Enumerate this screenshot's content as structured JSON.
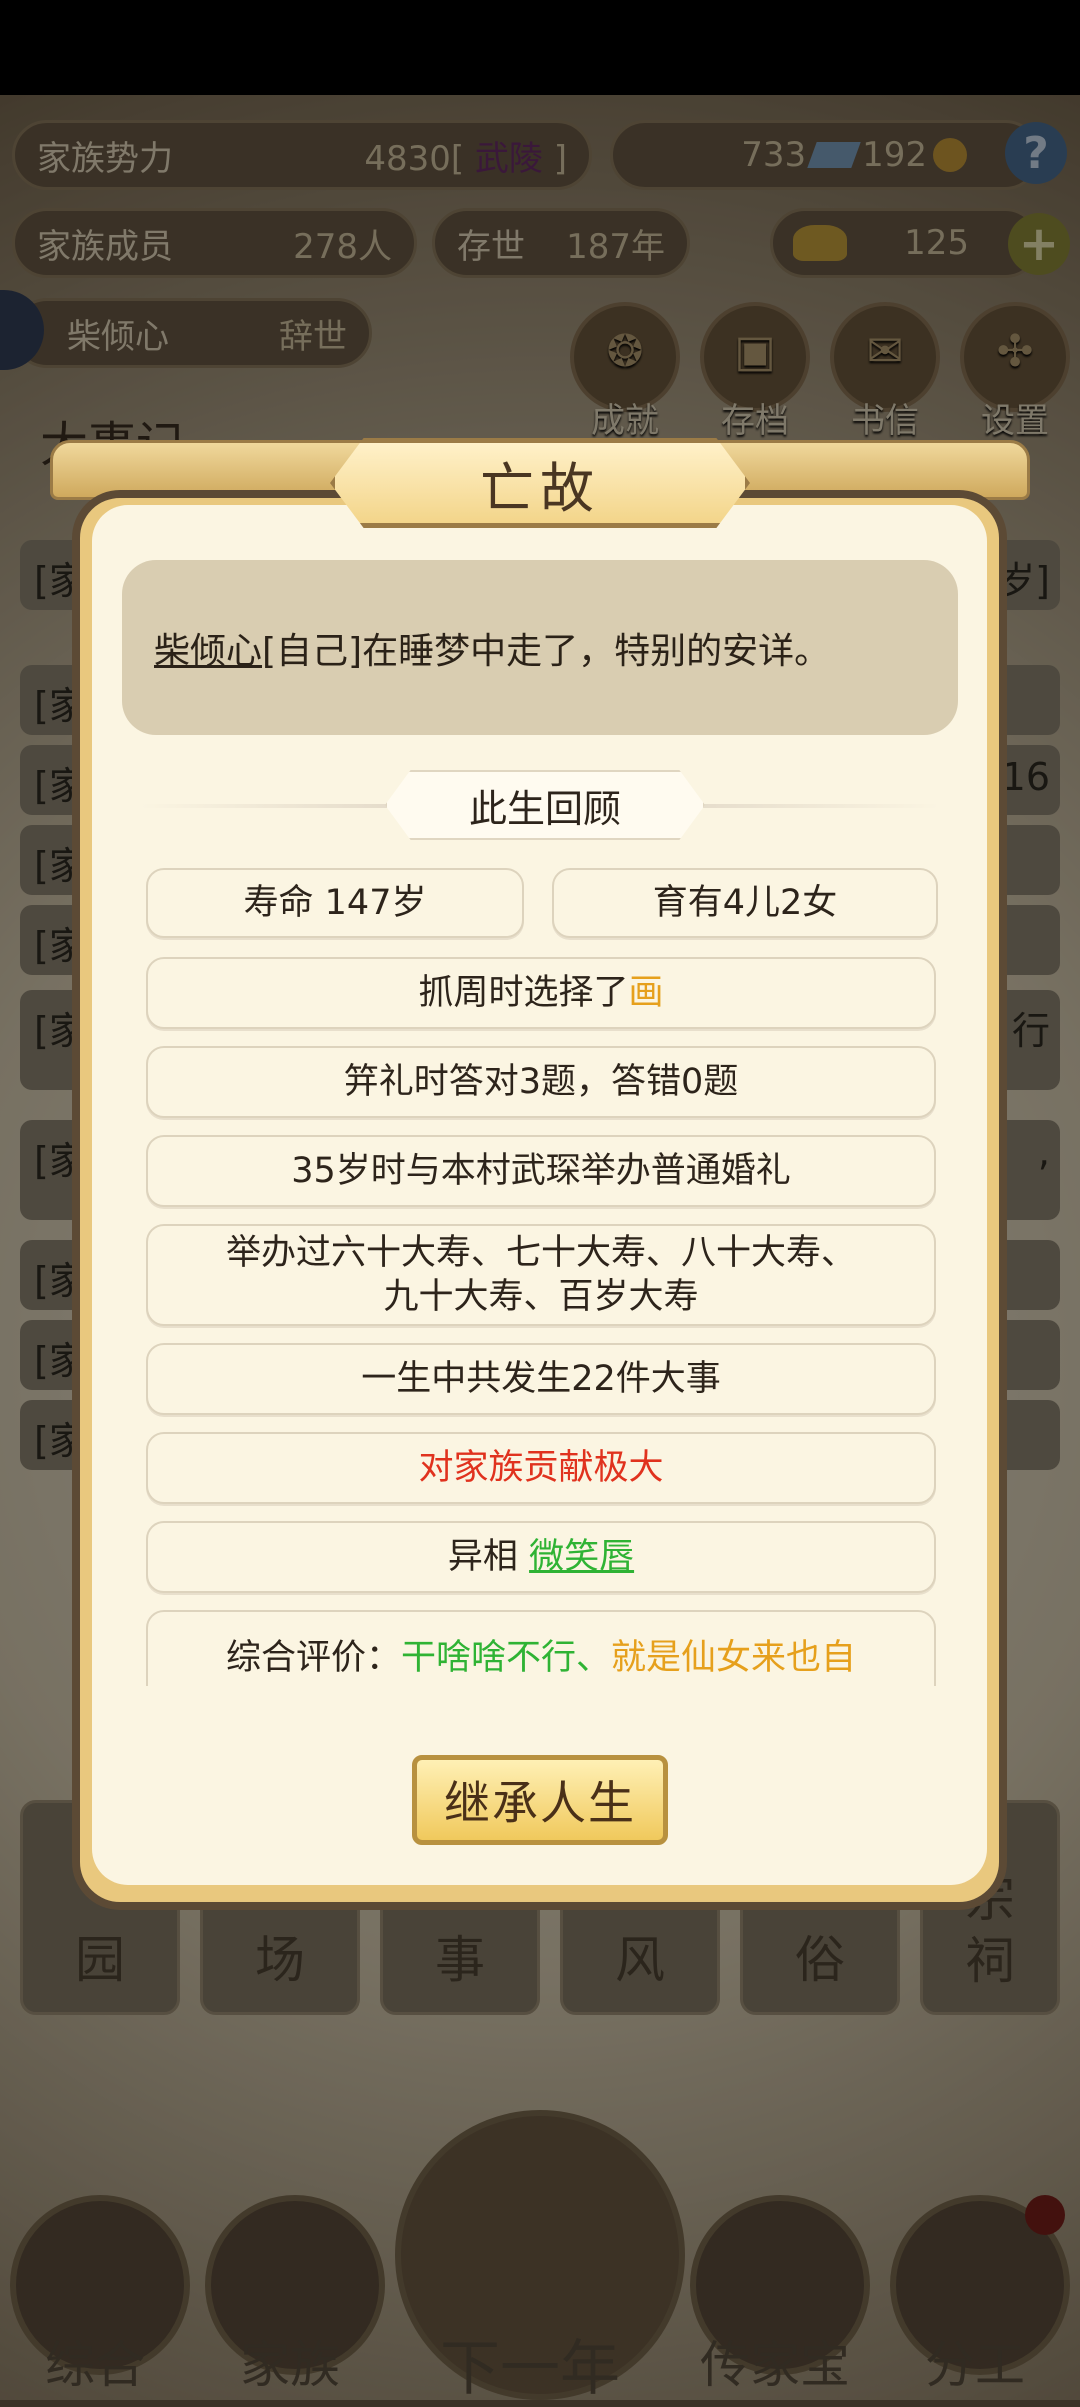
{
  "header": {
    "power_label": "家族势力",
    "power_value": "4830",
    "power_bracket_open": "[",
    "power_bracket_close": "]",
    "power_rank": "武陵",
    "currency_a": "733",
    "currency_b": "192",
    "help_icon": "?",
    "members_label": "家族成员",
    "members_value": "278人",
    "exist_label": "存世",
    "exist_value": "187年",
    "gold_value": "125",
    "add_icon": "+",
    "person_name": "柴倾心",
    "person_status": "辞世"
  },
  "top_buttons": [
    {
      "label": "成就",
      "icon": "achievement-icon"
    },
    {
      "label": "存档",
      "icon": "save-icon"
    },
    {
      "label": "书信",
      "icon": "letter-icon"
    },
    {
      "label": "设置",
      "icon": "settings-icon"
    }
  ],
  "background": {
    "section_title": "大事记",
    "rows": [
      "[家",
      "[家",
      "[家",
      "[家",
      "[家",
      "[家",
      "[家",
      "[家",
      "[家",
      "[家"
    ],
    "row_tails": [
      "岁]",
      "",
      "16",
      "",
      "",
      "行",
      ",",
      "",
      "",
      ""
    ],
    "tiles": [
      "园",
      "场",
      "事",
      "风",
      "俗",
      "宗祠"
    ],
    "nav": [
      "综合",
      "家族",
      "下一年",
      "传家宝",
      "分工"
    ]
  },
  "modal": {
    "title": "亡故",
    "message_name": "柴倾心",
    "message_rest": "[自己]在睡梦中走了，特别的安详。",
    "section_title": "此生回顾",
    "lifespan": "寿命 147岁",
    "children": "育有4儿2女",
    "zhuazhou_prefix": "抓周时选择了",
    "zhuazhou_item": "画",
    "jili": "笄礼时答对3题，答错0题",
    "wedding": "35岁时与本村武琛举办普通婚礼",
    "birthdays_line1": "举办过六十大寿、七十大寿、八十大寿、",
    "birthdays_line2": "九十大寿、百岁大寿",
    "events": "一生中共发生22件大事",
    "contribution": "对家族贡献极大",
    "trait_prefix": "异相",
    "trait_value": "微笑唇",
    "eval_prefix": "综合评价：",
    "eval_green": "干啥啥不行、",
    "eval_orange": "就是仙女来也自",
    "inherit_button": "继承人生"
  },
  "colors": {
    "orange": "#e6a01c",
    "red": "#e0321e",
    "green": "#2fb334",
    "modal_bg": "#fbf5e2"
  }
}
